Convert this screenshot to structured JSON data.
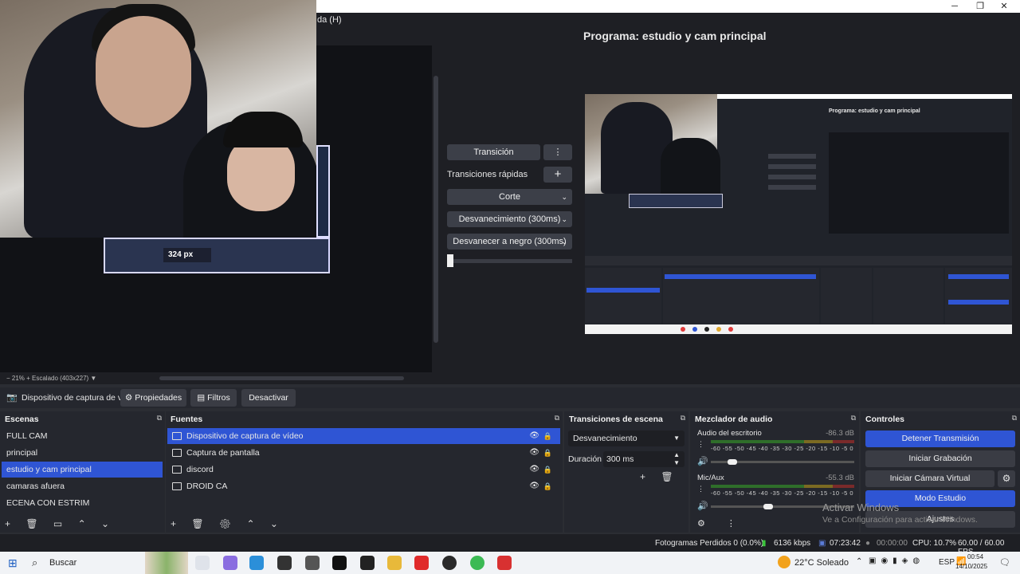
{
  "window": {
    "minimize": "─",
    "maximize": "❐",
    "close": "✕"
  },
  "menu": {
    "help_label": "da (H)"
  },
  "preview": {
    "nested_px_label": "324 px",
    "zoom_text": "−   21%   +   Escalado (403x227)   ▼"
  },
  "transition": {
    "button_label": "Transición",
    "menu_glyph": "⋮",
    "quick_label": "Transiciones rápidas",
    "add_glyph": "+",
    "items": [
      "Corte",
      "Desvanecimiento (300ms)",
      "Desvanecer a negro (300ms)"
    ],
    "chevron": "⌄"
  },
  "program": {
    "title": "Programa: estudio y cam principal",
    "mini_title": "Programa: estudio y cam principal"
  },
  "source_toolbar": {
    "source_name": "Dispositivo de captura de v",
    "properties_label": "Propiedades",
    "filters_label": "Filtros",
    "deactivate_label": "Desactivar"
  },
  "scenes": {
    "title": "Escenas",
    "items": [
      "FULL CAM",
      "principal",
      "estudio y cam principal",
      "camaras afuera",
      "ECENA CON ESTRIM"
    ],
    "selected_index": 2,
    "tools": "+ 🗑 ▭ ⌃ ⌄"
  },
  "sources": {
    "title": "Fuentes",
    "items": [
      "Dispositivo de captura de vídeo",
      "Captura de pantalla",
      "discord",
      "DROID CA"
    ],
    "selected_index": 0,
    "tools": "+ 🗑 ⚙ ⌃ ⌄"
  },
  "scene_transitions": {
    "title": "Transiciones de escena",
    "selected": "Desvanecimiento",
    "duration_label": "Duración",
    "duration_value": "300 ms",
    "tools": "+ 🗑 ⋮"
  },
  "mixer": {
    "title": "Mezclador de audio",
    "channels": [
      {
        "name": "Audio del escritorio",
        "db": "-86.3 dB",
        "scale": "-60 -55 -50 -45 -40 -35 -30 -25 -20 -15 -10 -5 0",
        "volume": 0.15
      },
      {
        "name": "Mic/Aux",
        "db": "-55.3 dB",
        "scale": "-60 -55 -50 -45 -40 -35 -30 -25 -20 -15 -10 -5 0",
        "volume": 0.4
      }
    ],
    "tools": "⚙ ⋮"
  },
  "controls": {
    "title": "Controles",
    "stop_stream": "Detener Transmisión",
    "start_record": "Iniciar Grabación",
    "start_vcam": "Iniciar Cámara Virtual",
    "studio_mode": "Modo Estudio",
    "settings": "Ajustes"
  },
  "watermark": {
    "title": "Activar Windows",
    "subtitle": "Ve a Configuración para activar Windows."
  },
  "status": {
    "dropped": "Fotogramas Perdidos 0 (0.0%)",
    "bitrate": "6136 kbps",
    "stream_time": "07:23:42",
    "rec_time": "00:00:00",
    "cpu": "CPU: 10.7%",
    "fps": "60.00 / 60.00 FPS"
  },
  "taskbar": {
    "search": "Buscar",
    "weather": "22°C  Soleado",
    "lang": "ESP",
    "time": "00:54",
    "date": "14/10/2025"
  },
  "colors": {
    "accent": "#2f55d4",
    "panel": "#25272e",
    "background": "#1e1f24"
  }
}
